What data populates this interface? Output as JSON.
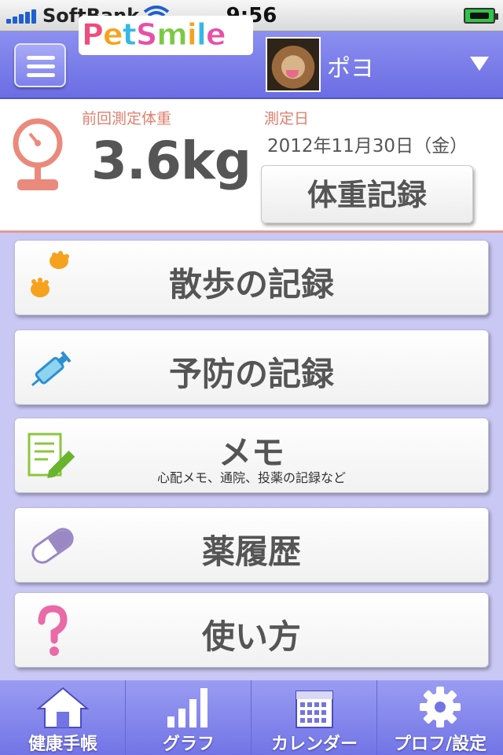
{
  "status_bar": {
    "carrier": "SoftBank",
    "time": "9:56"
  },
  "header": {
    "logo": [
      "P",
      "e",
      "t",
      "S",
      "m",
      "i",
      "l",
      "e"
    ],
    "logo_colors": [
      "#f04c7c",
      "#f6a21e",
      "#36b7e8",
      "#e84fa6",
      "#7ac943",
      "#f6a21e",
      "#36b7e8",
      "#e84fa6"
    ],
    "pet_name": "ポヨ"
  },
  "weight": {
    "prev_label": "前回測定体重",
    "value": "3.6kg",
    "date_label": "測定日",
    "date": "2012年11月30日（金）",
    "record_button": "体重記録"
  },
  "menu": [
    {
      "label": "散歩の記録",
      "icon": "paw-icon"
    },
    {
      "label": "予防の記録",
      "icon": "syringe-icon"
    },
    {
      "label": "メモ",
      "sub": "心配メモ、通院、投薬の記録など",
      "icon": "memo-icon"
    },
    {
      "label": "薬履歴",
      "icon": "capsule-icon"
    },
    {
      "label": "使い方",
      "icon": "question-icon"
    }
  ],
  "tabs": [
    {
      "label": "健康手帳",
      "icon": "home-icon"
    },
    {
      "label": "グラフ",
      "icon": "graph-icon"
    },
    {
      "label": "カレンダー",
      "icon": "calendar-icon"
    },
    {
      "label": "プロフ/設定",
      "icon": "gear-icon"
    }
  ],
  "colors": {
    "accent": "#7b7eea",
    "label_red": "#e07f6d",
    "background": "#c9c8f4"
  }
}
